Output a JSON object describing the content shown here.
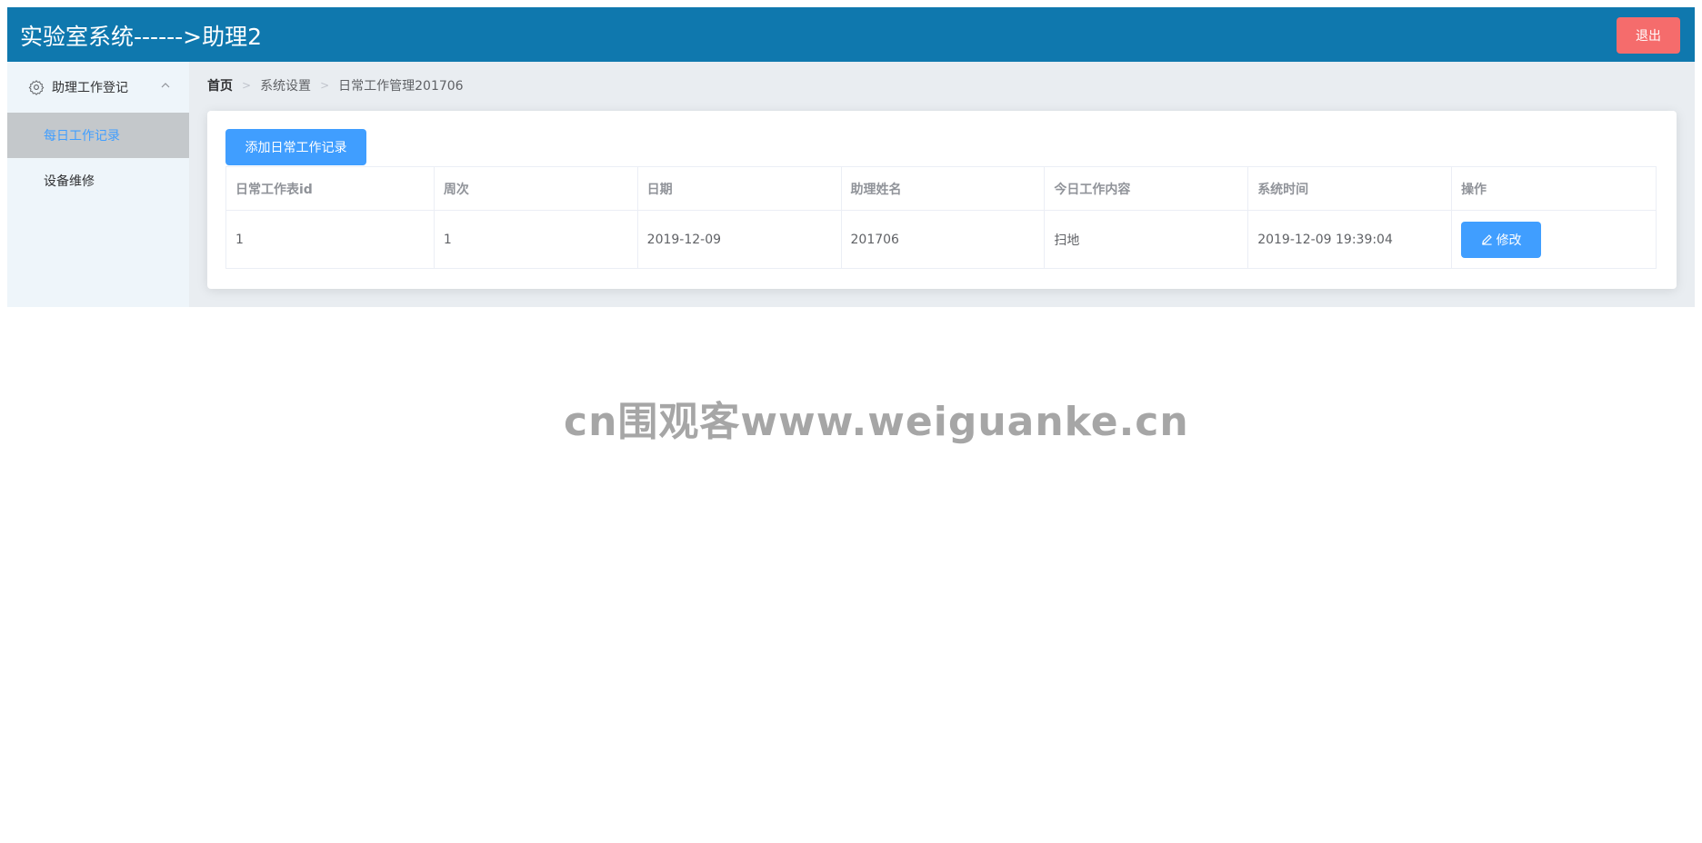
{
  "header": {
    "title": "实验室系统------>助理2",
    "logout_label": "退出"
  },
  "sidebar": {
    "group_label": "助理工作登记",
    "group_icon": "gear-icon",
    "items": [
      {
        "label": "每日工作记录",
        "active": true
      },
      {
        "label": "设备维修",
        "active": false
      }
    ]
  },
  "breadcrumb": [
    "首页",
    "系统设置",
    "日常工作管理201706"
  ],
  "main": {
    "add_label": "添加日常工作记录",
    "columns": [
      "日常工作表id",
      "周次",
      "日期",
      "助理姓名",
      "今日工作内容",
      "系统时间",
      "操作"
    ],
    "rows": [
      {
        "id": "1",
        "week": "1",
        "date": "2019-12-09",
        "name": "201706",
        "content": "扫地",
        "system_time": "2019-12-09 19:39:04",
        "action_label": "修改"
      }
    ]
  },
  "watermark": "cn围观客www.weiguanke.cn",
  "colors": {
    "header_bg": "#0f78ae",
    "primary": "#409eff",
    "danger": "#f56c6c",
    "sidebar_bg": "#eef5fa",
    "active_item_bg": "#c4c8cb"
  }
}
